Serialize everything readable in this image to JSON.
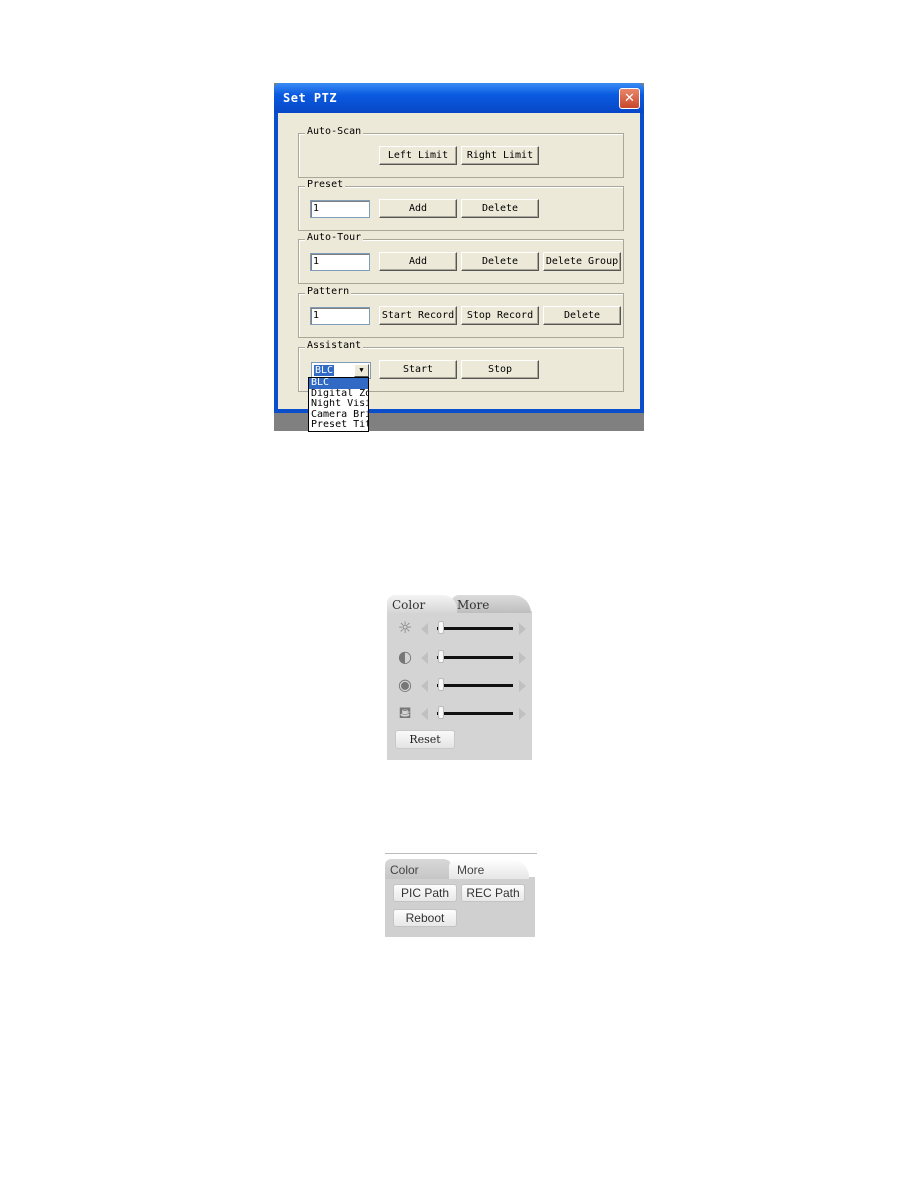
{
  "ptz_dialog": {
    "title": "Set PTZ",
    "close_icon": "close-x-icon",
    "auto_scan": {
      "label": "Auto-Scan",
      "left_limit": "Left Limit",
      "right_limit": "Right Limit"
    },
    "preset": {
      "label": "Preset",
      "value": "1",
      "add": "Add",
      "delete": "Delete"
    },
    "auto_tour": {
      "label": "Auto-Tour",
      "value": "1",
      "add": "Add",
      "delete": "Delete",
      "delete_group": "Delete Group"
    },
    "pattern": {
      "label": "Pattern",
      "value": "1",
      "start_record": "Start Record",
      "stop_record": "Stop Record",
      "delete": "Delete"
    },
    "assistant": {
      "label": "Assistant",
      "selected": "BLC",
      "start": "Start",
      "stop": "Stop",
      "options": [
        "BLC",
        "Digital Zoom",
        "Night Vision",
        "Camera Brightness",
        "Preset Title"
      ]
    }
  },
  "color_panel": {
    "tabs": [
      "Color",
      "More"
    ],
    "active_tab": "Color",
    "sliders": [
      {
        "name": "brightness",
        "icon": "brightness-sun-icon",
        "value": 0
      },
      {
        "name": "contrast",
        "icon": "contrast-icon",
        "value": 0
      },
      {
        "name": "saturation",
        "icon": "palette-icon",
        "value": 0
      },
      {
        "name": "hue",
        "icon": "paint-bucket-icon",
        "value": 0
      }
    ],
    "reset": "Reset"
  },
  "more_panel": {
    "tabs": [
      "Color",
      "More"
    ],
    "active_tab": "More",
    "pic_path": "PIC Path",
    "rec_path": "REC Path",
    "reboot": "Reboot"
  }
}
